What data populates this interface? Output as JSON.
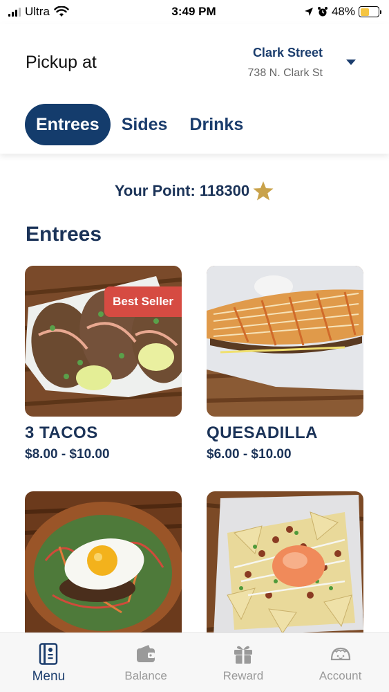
{
  "status_bar": {
    "carrier": "Ultra",
    "time": "3:49 PM",
    "battery_percent": "48%",
    "battery_level": 0.48,
    "icons": [
      "signal-icon",
      "wifi-icon",
      "location-arrow-icon",
      "alarm-icon",
      "battery-charging-icon"
    ]
  },
  "header": {
    "pickup_label": "Pickup at",
    "location_name": "Clark Street",
    "location_address": "738 N. Clark St",
    "tabs": [
      {
        "label": "Entrees",
        "active": true
      },
      {
        "label": "Sides",
        "active": false
      },
      {
        "label": "Drinks",
        "active": false
      }
    ]
  },
  "points": {
    "label": "Your Point: 118300",
    "icon": "star-icon",
    "star_color": "#c9a24a"
  },
  "section": {
    "title": "Entrees"
  },
  "items": [
    {
      "name": "3 TACOS",
      "price": "$8.00 - $10.00",
      "badge": "Best Seller"
    },
    {
      "name": "QUESADILLA",
      "price": "$6.00 - $10.00"
    },
    {
      "name": "",
      "price": ""
    },
    {
      "name": "",
      "price": ""
    }
  ],
  "tabbar": [
    {
      "label": "Menu",
      "icon": "menu-book-icon",
      "active": true
    },
    {
      "label": "Balance",
      "icon": "wallet-icon",
      "active": false
    },
    {
      "label": "Reward",
      "icon": "gift-icon",
      "active": false
    },
    {
      "label": "Account",
      "icon": "taco-face-icon",
      "active": false
    }
  ],
  "colors": {
    "primary": "#143c6c",
    "badge": "#d64b42",
    "text": "#1b3358"
  }
}
